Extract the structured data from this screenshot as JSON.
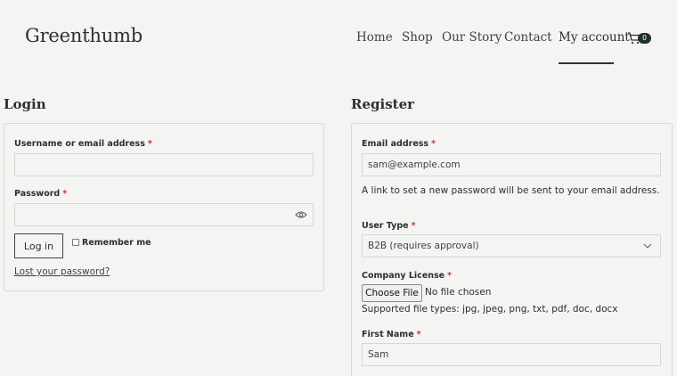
{
  "header": {
    "brand": "Greenthumb",
    "nav": [
      {
        "label": "Home"
      },
      {
        "label": "Shop"
      },
      {
        "label": "Our Story"
      },
      {
        "label": "Contact"
      },
      {
        "label": "My account",
        "active": true
      }
    ],
    "cart_count": "0"
  },
  "login": {
    "title": "Login",
    "username_label": "Username or email address",
    "password_label": "Password",
    "required_mark": "*",
    "username_value": "",
    "password_value": "",
    "login_button": "Log in",
    "remember_label": "Remember me",
    "lost_password": "Lost your password?"
  },
  "register": {
    "title": "Register",
    "email_label": "Email address",
    "email_value": "sam@example.com",
    "email_hint": "A link to set a new password will be sent to your email address.",
    "user_type_label": "User Type",
    "user_type_value": "B2B (requires approval)",
    "license_label": "Company License",
    "choose_file": "Choose File",
    "no_file": "No file chosen",
    "file_types": "Supported file types: jpg, jpeg, png, txt, pdf, doc, docx",
    "first_name_label": "First Name",
    "first_name_value": "Sam"
  },
  "colors": {
    "background": "#f4f4f2",
    "text": "#2c2f2f",
    "required": "#c0392b",
    "border": "#d7d7d4"
  }
}
